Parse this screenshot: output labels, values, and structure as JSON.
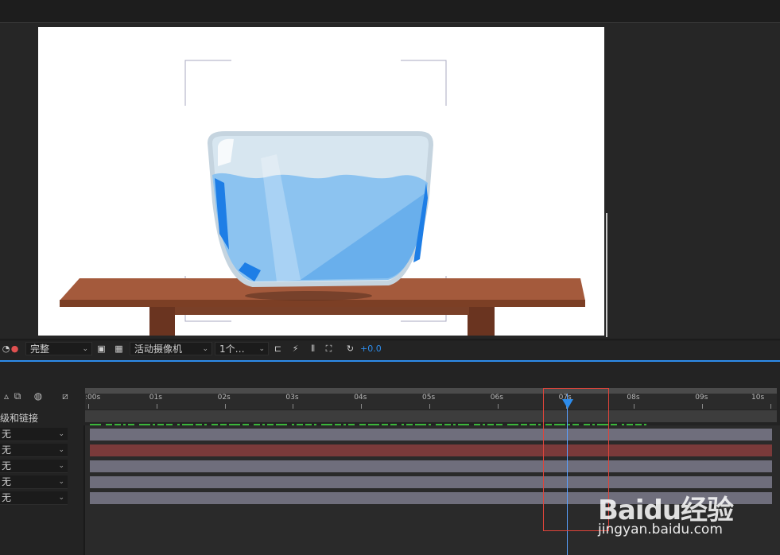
{
  "viewer": {
    "toolbar": {
      "resolution": "完整",
      "camera": "活动摄像机",
      "views": "1个…",
      "exposure": "+0.0"
    }
  },
  "timeline": {
    "header_label": "级和链接",
    "ticks": [
      ":00s",
      "01s",
      "02s",
      "03s",
      "04s",
      "05s",
      "06s",
      "07s",
      "08s",
      "09s",
      "10s"
    ],
    "rows": [
      {
        "parent": "无",
        "bar_color": "#6f6e7c"
      },
      {
        "parent": "无",
        "bar_color": "#7a3a3a"
      },
      {
        "parent": "无",
        "bar_color": "#6f6e7c"
      },
      {
        "parent": "无",
        "bar_color": "#6f6e7c"
      },
      {
        "parent": "无",
        "bar_color": "#6f6e7c"
      }
    ],
    "playhead_time_fraction": 0.7
  },
  "watermark": {
    "brand": "Baidu经验",
    "url": "jingyan.baidu.com"
  },
  "colors": {
    "accent": "#2d8ceb",
    "highlight": "#e0443a"
  }
}
